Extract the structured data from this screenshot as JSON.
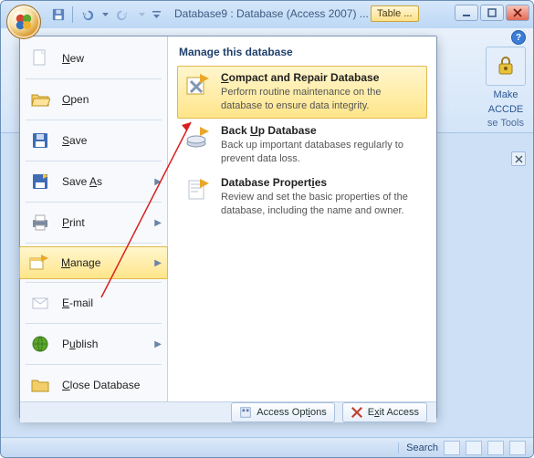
{
  "window": {
    "title": "Database9 : Database (Access 2007) ...",
    "tab_tools_label": "Table ..."
  },
  "ribbon": {
    "make_accde": {
      "line1": "Make",
      "line2": "ACCDE"
    },
    "group_label": "se Tools",
    "help": "?"
  },
  "menu": {
    "left": [
      {
        "label": "New",
        "accel": "N",
        "arrow": false
      },
      {
        "label": "Open",
        "accel": "O",
        "arrow": false
      },
      {
        "label": "Save",
        "accel": "S",
        "arrow": false
      },
      {
        "label": "Save As",
        "accel": "A",
        "arrow": true
      },
      {
        "label": "Print",
        "accel": "P",
        "arrow": true
      },
      {
        "label": "Manage",
        "accel": "M",
        "arrow": true,
        "selected": true
      },
      {
        "label": "E-mail",
        "accel": "E",
        "arrow": false
      },
      {
        "label": "Publish",
        "accel": "u",
        "arrow": true
      },
      {
        "label": "Close Database",
        "accel": "C",
        "arrow": false
      }
    ],
    "right_title": "Manage this database",
    "right": [
      {
        "title": "Compact and Repair Database",
        "desc": "Perform routine maintenance on the database to ensure data integrity.",
        "selected": true
      },
      {
        "title": "Back Up Database",
        "desc": "Back up important databases regularly to prevent data loss."
      },
      {
        "title": "Database Properties",
        "desc": "Review and set the basic properties of the database, including the name and owner."
      }
    ],
    "footer": {
      "options": "Access Options",
      "exit": "Exit Access"
    }
  },
  "statusbar": {
    "search": "Search"
  }
}
